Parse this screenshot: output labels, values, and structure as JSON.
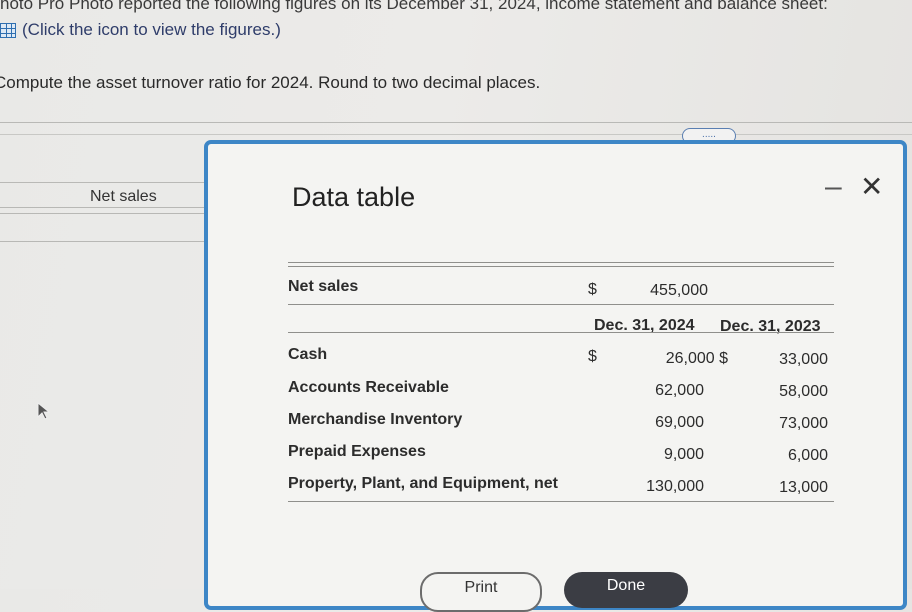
{
  "problem": {
    "intro": "hoto Pro Photo reported the following figures on its December 31, 2024, income statement and balance sheet:",
    "icon_link": "(Click the icon to view the figures.)",
    "question": "Compute the asset turnover ratio for 2024. Round to two decimal places."
  },
  "background": {
    "net_sales_label": "Net sales",
    "more_button": "....."
  },
  "modal": {
    "title": "Data table",
    "minimize_symbol": "–",
    "close_symbol": "✕",
    "table": {
      "net_sales": {
        "label": "Net sales",
        "currency": "$",
        "value": "455,000"
      },
      "headers": {
        "col1": "Dec. 31, 2024",
        "col2": "Dec. 31, 2023"
      },
      "rows": [
        {
          "label": "Cash",
          "currency1": "$",
          "v2024": "26,000 $",
          "v2023": "33,000"
        },
        {
          "label": "Accounts Receivable",
          "currency1": "",
          "v2024": "62,000",
          "v2023": "58,000"
        },
        {
          "label": "Merchandise Inventory",
          "currency1": "",
          "v2024": "69,000",
          "v2023": "73,000"
        },
        {
          "label": "Prepaid Expenses",
          "currency1": "",
          "v2024": "9,000",
          "v2023": "6,000"
        },
        {
          "label": "Property, Plant, and Equipment, net",
          "currency1": "",
          "v2024": "130,000",
          "v2023": "13,000"
        }
      ]
    },
    "print_label": "Print",
    "done_label": "Done"
  },
  "icons": {
    "table": "grid-icon",
    "cursor": "pointer-cursor-icon"
  },
  "colors": {
    "modal_border": "#3d86c6",
    "done_bg": "#3b3d44",
    "link": "#2f3d6a"
  }
}
